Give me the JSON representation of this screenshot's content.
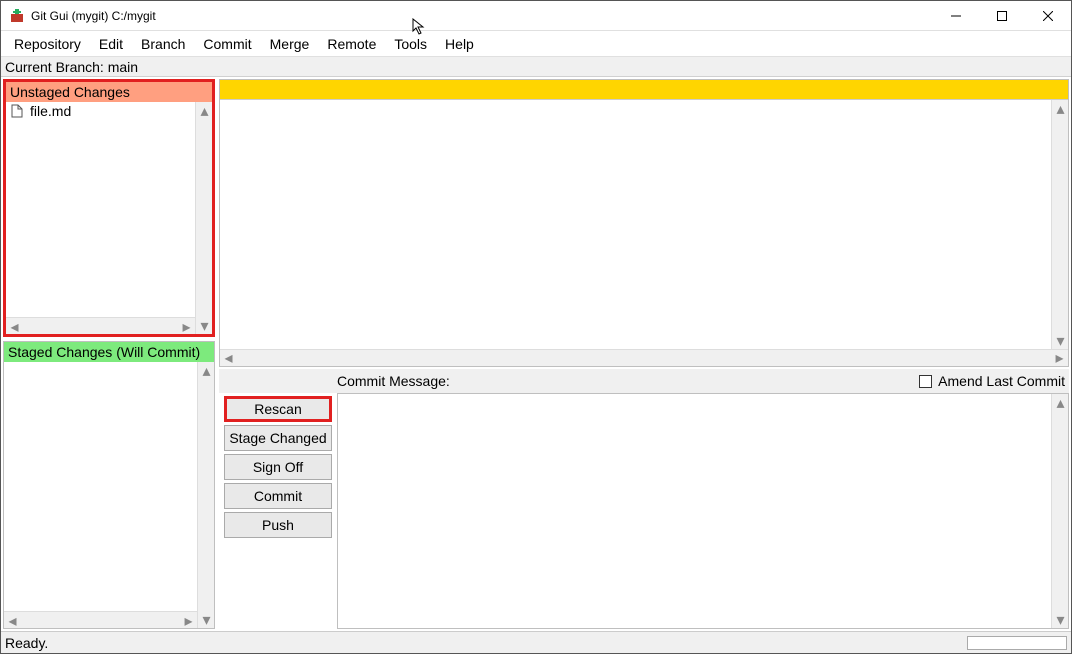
{
  "window": {
    "title": "Git Gui (mygit) C:/mygit"
  },
  "menu": {
    "items": [
      "Repository",
      "Edit",
      "Branch",
      "Commit",
      "Merge",
      "Remote",
      "Tools",
      "Help"
    ]
  },
  "branch_line": "Current Branch: main",
  "panels": {
    "unstaged_header": "Unstaged Changes",
    "staged_header": "Staged Changes (Will Commit)",
    "unstaged_files": [
      {
        "icon": "file-icon",
        "name": "file.md"
      }
    ],
    "staged_files": []
  },
  "commit": {
    "message_label": "Commit Message:",
    "amend_label": "Amend Last Commit",
    "amend_checked": false,
    "buttons": {
      "rescan": "Rescan",
      "stage_changed": "Stage Changed",
      "sign_off": "Sign Off",
      "commit": "Commit",
      "push": "Push"
    }
  },
  "status": {
    "text": "Ready."
  },
  "highlights": {
    "unstaged_panel": true,
    "rescan_button": true
  }
}
